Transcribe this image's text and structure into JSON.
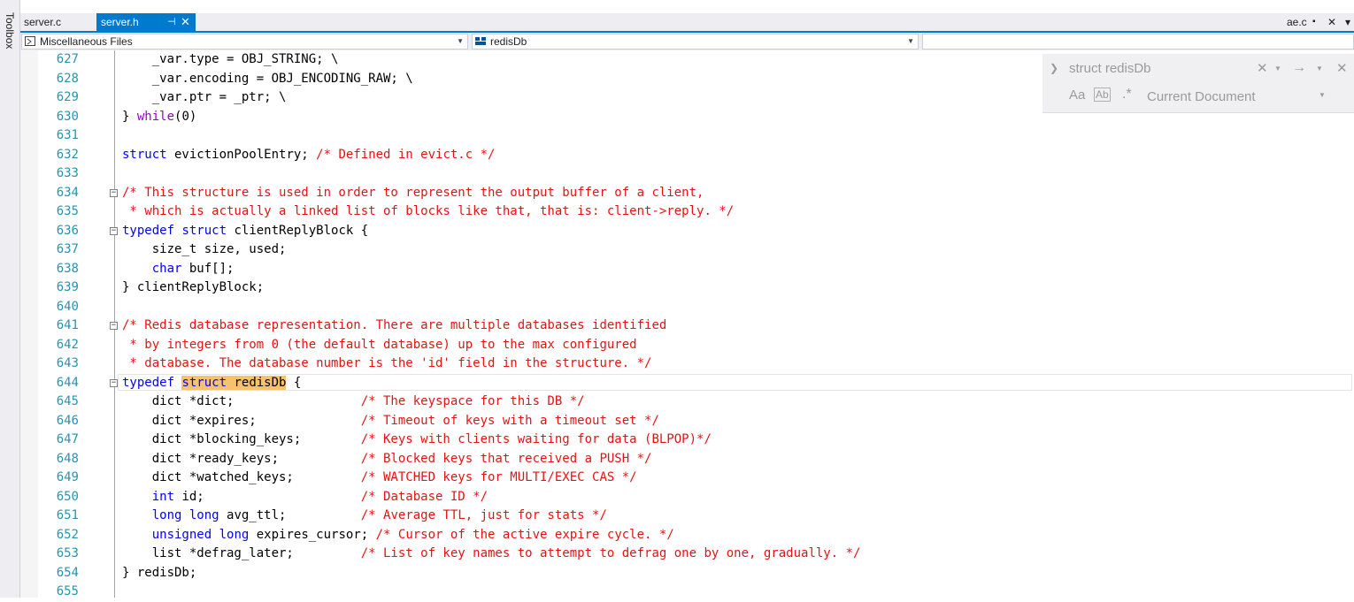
{
  "toolbox": {
    "label": "Toolbox"
  },
  "tabs": [
    {
      "label": "server.c",
      "active": false
    },
    {
      "label": "server.h",
      "active": true,
      "pin": "⊣",
      "close": "✕"
    }
  ],
  "tabbar_right": {
    "file": "ae.c",
    "pin": "▪",
    "close": "✕",
    "dropdown": "▾"
  },
  "navbar": {
    "project": "Miscellaneous Files",
    "scope": "redisDb",
    "member": ""
  },
  "find": {
    "query": "struct redisDb",
    "scope": "Current Document",
    "match_case_glyph": "Aa",
    "whole_word_glyph": "Ab",
    "regex_glyph": ".*"
  },
  "colors": {
    "accent": "#007acc",
    "keyword": "#0000ff",
    "comment": "#e41414",
    "control": "#8f08c4",
    "line_number": "#2b91af",
    "highlight": "#f6c26e"
  },
  "lines": [
    {
      "n": "627",
      "fold": "",
      "segments": [
        {
          "t": "    _var.type = OBJ_STRING; \\",
          "c": ""
        }
      ]
    },
    {
      "n": "628",
      "fold": "",
      "segments": [
        {
          "t": "    _var.encoding = OBJ_ENCODING_RAW; \\",
          "c": ""
        }
      ]
    },
    {
      "n": "629",
      "fold": "",
      "segments": [
        {
          "t": "    _var.ptr = _ptr; \\",
          "c": ""
        }
      ]
    },
    {
      "n": "630",
      "fold": "",
      "segments": [
        {
          "t": "} ",
          "c": ""
        },
        {
          "t": "while",
          "c": "ctrl"
        },
        {
          "t": "(0)",
          "c": ""
        }
      ]
    },
    {
      "n": "631",
      "fold": "",
      "segments": []
    },
    {
      "n": "632",
      "fold": "",
      "segments": [
        {
          "t": "struct",
          "c": "kw"
        },
        {
          "t": " evictionPoolEntry; ",
          "c": ""
        },
        {
          "t": "/* Defined in evict.c */",
          "c": "cm"
        }
      ]
    },
    {
      "n": "633",
      "fold": "",
      "segments": []
    },
    {
      "n": "634",
      "fold": "−",
      "segments": [
        {
          "t": "/* This structure is used in order to represent the output buffer of a client,",
          "c": "cm"
        }
      ]
    },
    {
      "n": "635",
      "fold": "",
      "segments": [
        {
          "t": " * which is actually a linked list of blocks like that, that is: client->reply. */",
          "c": "cm"
        }
      ]
    },
    {
      "n": "636",
      "fold": "−",
      "segments": [
        {
          "t": "typedef",
          "c": "kw"
        },
        {
          "t": " ",
          "c": ""
        },
        {
          "t": "struct",
          "c": "kw"
        },
        {
          "t": " clientReplyBlock {",
          "c": ""
        }
      ]
    },
    {
      "n": "637",
      "fold": "",
      "segments": [
        {
          "t": "    size_t size, used;",
          "c": ""
        }
      ]
    },
    {
      "n": "638",
      "fold": "",
      "segments": [
        {
          "t": "    ",
          "c": ""
        },
        {
          "t": "char",
          "c": "kw"
        },
        {
          "t": " buf[];",
          "c": ""
        }
      ]
    },
    {
      "n": "639",
      "fold": "",
      "segments": [
        {
          "t": "} clientReplyBlock;",
          "c": ""
        }
      ]
    },
    {
      "n": "640",
      "fold": "",
      "segments": []
    },
    {
      "n": "641",
      "fold": "−",
      "segments": [
        {
          "t": "/* Redis database representation. There are multiple databases identified",
          "c": "cm"
        }
      ]
    },
    {
      "n": "642",
      "fold": "",
      "segments": [
        {
          "t": " * by integers from 0 (the default database) up to the max configured",
          "c": "cm"
        }
      ]
    },
    {
      "n": "643",
      "fold": "",
      "segments": [
        {
          "t": " * database. The database number is the 'id' field in the structure. */",
          "c": "cm"
        }
      ]
    },
    {
      "n": "644",
      "fold": "−",
      "current": true,
      "segments": [
        {
          "t": "typedef",
          "c": "kw"
        },
        {
          "t": " ",
          "c": ""
        },
        {
          "t": "struct",
          "c": "kw hl"
        },
        {
          "t": " redisDb",
          "c": "hl"
        },
        {
          "t": " {",
          "c": ""
        }
      ]
    },
    {
      "n": "645",
      "fold": "",
      "segments": [
        {
          "t": "    dict *dict;                 ",
          "c": ""
        },
        {
          "t": "/* The keyspace for this DB */",
          "c": "cm"
        }
      ]
    },
    {
      "n": "646",
      "fold": "",
      "segments": [
        {
          "t": "    dict *expires;              ",
          "c": ""
        },
        {
          "t": "/* Timeout of keys with a timeout set */",
          "c": "cm"
        }
      ]
    },
    {
      "n": "647",
      "fold": "",
      "segments": [
        {
          "t": "    dict *blocking_keys;        ",
          "c": ""
        },
        {
          "t": "/* Keys with clients waiting for data (BLPOP)*/",
          "c": "cm"
        }
      ]
    },
    {
      "n": "648",
      "fold": "",
      "segments": [
        {
          "t": "    dict *ready_keys;           ",
          "c": ""
        },
        {
          "t": "/* Blocked keys that received a PUSH */",
          "c": "cm"
        }
      ]
    },
    {
      "n": "649",
      "fold": "",
      "segments": [
        {
          "t": "    dict *watched_keys;         ",
          "c": ""
        },
        {
          "t": "/* WATCHED keys for MULTI/EXEC CAS */",
          "c": "cm"
        }
      ]
    },
    {
      "n": "650",
      "fold": "",
      "segments": [
        {
          "t": "    ",
          "c": ""
        },
        {
          "t": "int",
          "c": "kw"
        },
        {
          "t": " id;                     ",
          "c": ""
        },
        {
          "t": "/* Database ID */",
          "c": "cm"
        }
      ]
    },
    {
      "n": "651",
      "fold": "",
      "segments": [
        {
          "t": "    ",
          "c": ""
        },
        {
          "t": "long",
          "c": "kw"
        },
        {
          "t": " ",
          "c": ""
        },
        {
          "t": "long",
          "c": "kw"
        },
        {
          "t": " avg_ttl;          ",
          "c": ""
        },
        {
          "t": "/* Average TTL, just for stats */",
          "c": "cm"
        }
      ]
    },
    {
      "n": "652",
      "fold": "",
      "segments": [
        {
          "t": "    ",
          "c": ""
        },
        {
          "t": "unsigned",
          "c": "kw"
        },
        {
          "t": " ",
          "c": ""
        },
        {
          "t": "long",
          "c": "kw"
        },
        {
          "t": " expires_cursor; ",
          "c": ""
        },
        {
          "t": "/* Cursor of the active expire cycle. */",
          "c": "cm"
        }
      ]
    },
    {
      "n": "653",
      "fold": "",
      "segments": [
        {
          "t": "    list *defrag_later;         ",
          "c": ""
        },
        {
          "t": "/* List of key names to attempt to defrag one by one, gradually. */",
          "c": "cm"
        }
      ]
    },
    {
      "n": "654",
      "fold": "",
      "segments": [
        {
          "t": "} redisDb;",
          "c": ""
        }
      ]
    },
    {
      "n": "655",
      "fold": "",
      "segments": []
    }
  ]
}
